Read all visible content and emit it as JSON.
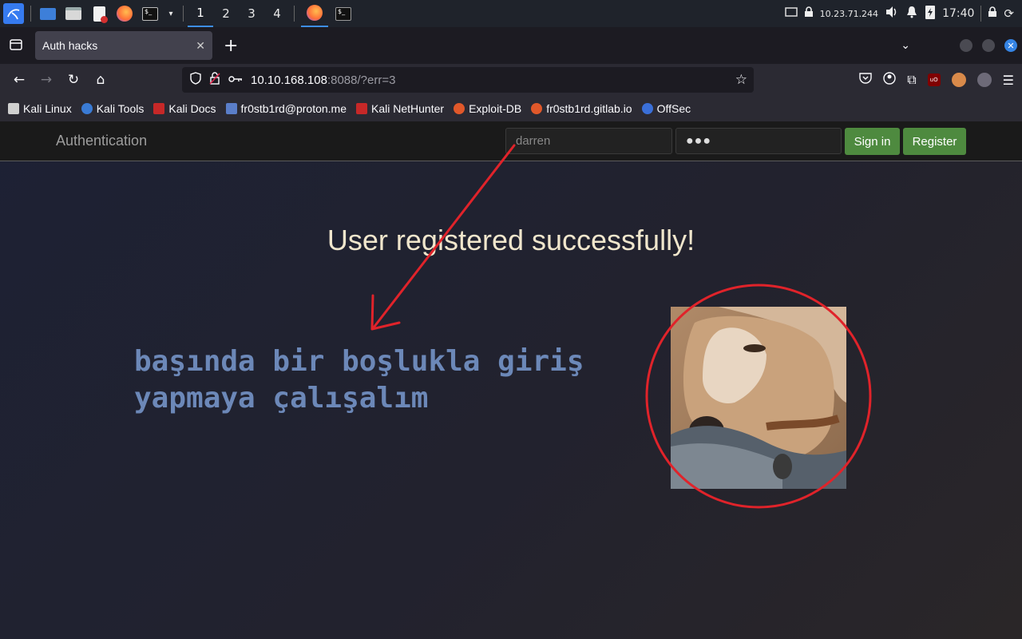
{
  "taskbar": {
    "workspaces": [
      "1",
      "2",
      "3",
      "4"
    ],
    "active_workspace": "1",
    "ip": "10.23.71.244",
    "time": "17:40"
  },
  "tab": {
    "title": "Auth hacks"
  },
  "urlbar": {
    "host": "10.10.168.108",
    "rest": ":8088/?err=3"
  },
  "bookmarks": [
    {
      "label": "Kali Linux",
      "color": "#d0d0d0"
    },
    {
      "label": "Kali Tools",
      "color": "#3a7bd5"
    },
    {
      "label": "Kali Docs",
      "color": "#c62828"
    },
    {
      "label": "fr0stb1rd@proton.me",
      "color": "#5a7ec9"
    },
    {
      "label": "Kali NetHunter",
      "color": "#c62828"
    },
    {
      "label": "Exploit-DB",
      "color": "#e0582a"
    },
    {
      "label": "fr0stb1rd.gitlab.io",
      "color": "#e0582a"
    },
    {
      "label": "OffSec",
      "color": "#3a6fd8"
    }
  ],
  "site": {
    "brand": "Authentication",
    "username_value": "darren",
    "password_value": "●●●",
    "signin_label": "Sign in",
    "register_label": "Register",
    "message": "User registered successfully!"
  },
  "annotation": {
    "line1": "başında bir boşlukla giriş",
    "line2": "yapmaya çalışalım"
  },
  "colors": {
    "annotation_red": "#e0232a",
    "button_green": "#4e8a3f",
    "note_blue": "#6c88b8"
  }
}
